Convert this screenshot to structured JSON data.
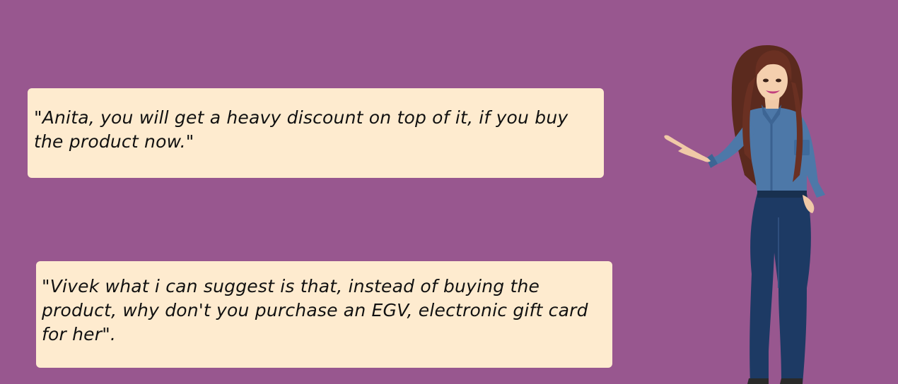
{
  "scene": {
    "background_color": "#98578f",
    "bubble_color": "#feebcf"
  },
  "dialogue": [
    {
      "text": "\"Anita, you will get a heavy discount on top of it, if you buy the product now.\""
    },
    {
      "text": "\"Vivek what i can suggest is that, instead of buying the product, why don't you purchase an EGV, electronic gift card for her\"."
    }
  ],
  "character": {
    "icon": "presenter-woman-illustration"
  }
}
